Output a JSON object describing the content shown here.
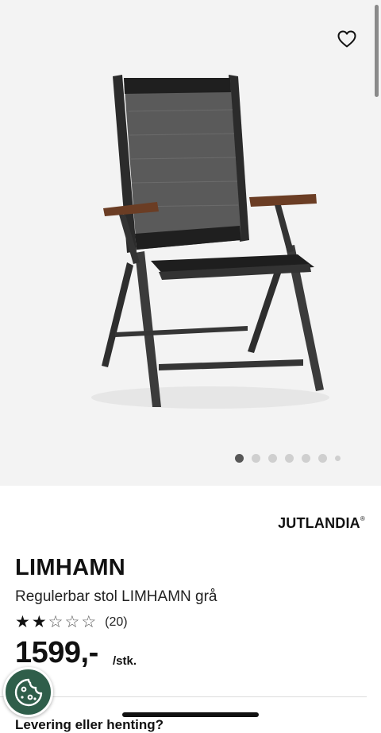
{
  "product": {
    "brand": "JUTLANDIA",
    "brand_mark": "®",
    "name": "LIMHAMN",
    "description": "Regulerbar stol LIMHAMN grå",
    "rating": {
      "value": 2,
      "max": 5,
      "reviews": "(20)"
    },
    "price": "1599,-",
    "unit": "/stk."
  },
  "gallery": {
    "image": "reclining-garden-chair",
    "image_count": 7,
    "active_index": 0
  },
  "icons": {
    "favorite": "heart-icon",
    "cookie": "cookie-icon"
  },
  "section": {
    "delivery_heading": "Levering eller henting?"
  },
  "colors": {
    "hero_bg": "#f3f3f3",
    "cookie_bg": "#2f5e4a",
    "dot_active": "#575757",
    "dot_inactive": "#cfcfcf"
  }
}
